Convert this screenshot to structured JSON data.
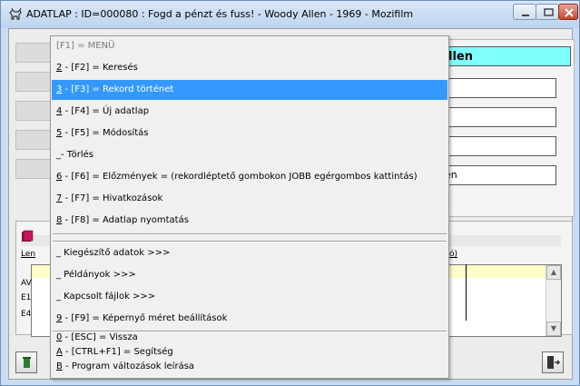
{
  "window": {
    "title": "ADATLAP : ID=000080 : Fogd a pénzt és fuss! - Woody Allen - 1969 - Mozifilm",
    "icon": "goat-icon"
  },
  "fields": {
    "director_visible": "llen",
    "row5_visible": "en"
  },
  "lower": {
    "header_left": "Len",
    "header_right": "ó)",
    "rows": [
      "AV",
      "E1",
      "E4"
    ]
  },
  "menu": {
    "items": [
      {
        "key": "",
        "text": "[F1] = MENÜ",
        "state": "disabled"
      },
      {
        "key": "2",
        "text": " - [F2] = Keresés"
      },
      {
        "key": "3",
        "text": " - [F3] = Rekord történet",
        "state": "selected"
      },
      {
        "key": "4",
        "text": " - [F4] = Új adatlap"
      },
      {
        "key": "5",
        "text": " - [F5] = Módosítás"
      },
      {
        "key": "",
        "text": "_- Törlés"
      },
      {
        "key": "6",
        "text": " - [F6] = Előzmények = (rekordléptető gombokon JOBB egérgombos kattintás)"
      },
      {
        "key": "7",
        "text": " - [F7] = Hivatkozások"
      },
      {
        "key": "8",
        "text": " - [F8] = Adatlap nyomtatás"
      },
      {
        "key": "",
        "text": "_ Kiegészítő adatok >>>"
      },
      {
        "key": "",
        "text": "_ Példányok >>>"
      },
      {
        "key": "",
        "text": "_ Kapcsolt fájlok >>>"
      },
      {
        "key": "9",
        "text": " - [F9] = Képernyő méret beállítások"
      },
      {
        "key": "0",
        "text": " - [ESC] = Vissza"
      },
      {
        "key": "A",
        "text": " - [CTRL+F1] = Segítség"
      },
      {
        "key": "B",
        "text": " - Program változások leírása"
      }
    ]
  }
}
